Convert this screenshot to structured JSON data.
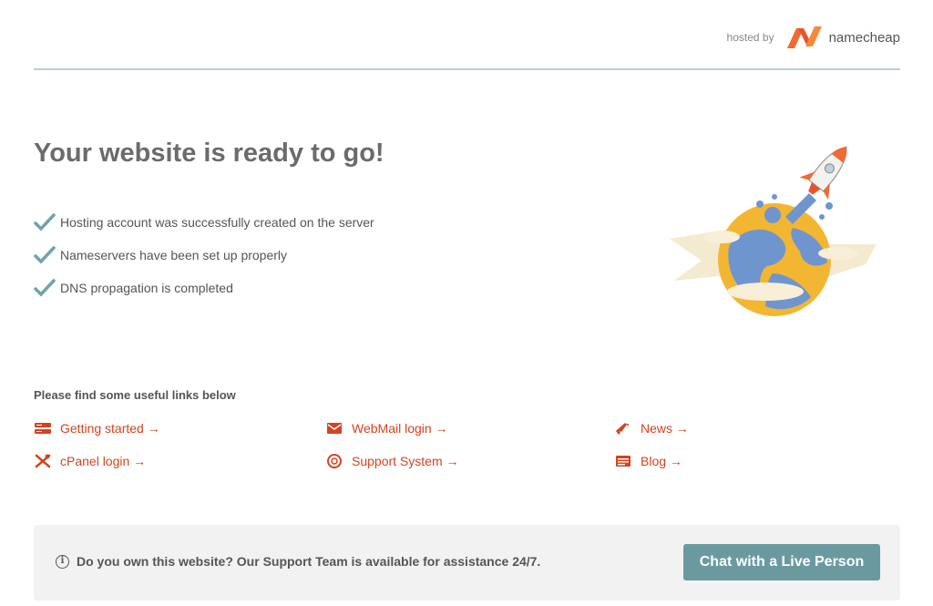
{
  "header": {
    "hosted_by": "hosted by",
    "brand": "namecheap",
    "brand_color": "#f06a35",
    "divider_color": "#b9cfd6"
  },
  "main": {
    "title": "Your website is ready to go!",
    "checklist": [
      {
        "icon": "check-icon",
        "text": "Hosting account was successfully created on the server"
      },
      {
        "icon": "check-icon",
        "text": "Nameservers have been set up properly"
      },
      {
        "icon": "check-icon",
        "text": "DNS propagation is completed"
      }
    ],
    "check_color": "#6fa3a8",
    "illustration": "rocket-globe-illustration"
  },
  "links": {
    "heading": "Please find some useful links below",
    "color": "#d4431f",
    "items": [
      {
        "icon": "server-icon",
        "label": "Getting started →"
      },
      {
        "icon": "mail-icon",
        "label": "WebMail login →"
      },
      {
        "icon": "megaphone-icon",
        "label": "News →"
      },
      {
        "icon": "tools-icon",
        "label": "cPanel login →"
      },
      {
        "icon": "lifebuoy-icon",
        "label": "Support System →"
      },
      {
        "icon": "blog-icon",
        "label": "Blog →"
      }
    ]
  },
  "footer": {
    "info_icon": "i",
    "message": "Do you own this website? Our Support Team is available for assistance 24/7.",
    "chat_button": "Chat with a Live Person",
    "button_color": "#6a9aa0"
  }
}
